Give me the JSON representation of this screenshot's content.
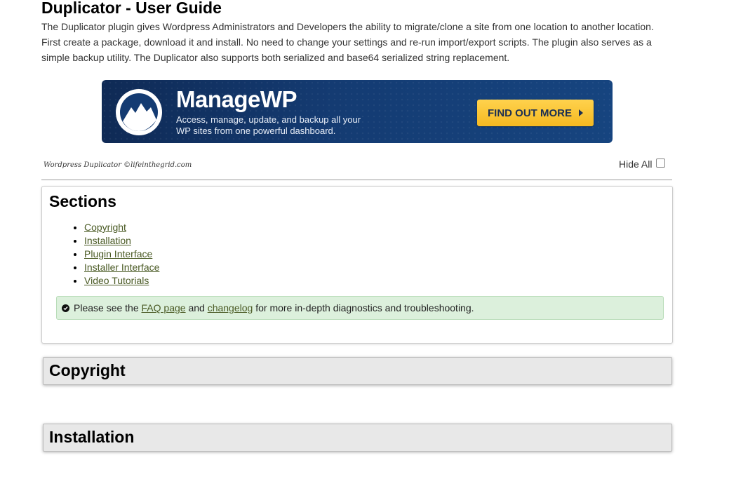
{
  "page": {
    "title": "Duplicator - User Guide",
    "intro": "The Duplicator plugin gives Wordpress Administrators and Developers the ability to migrate/clone a site from one location to another location. First create a package, download it and install. No need to change your settings and re-run import/export scripts. The plugin also serves as a simple backup utility. The Duplicator also supports both serialized and base64 serialized string replacement."
  },
  "banner": {
    "brand": "ManageWP",
    "tagline_line1": "Access, manage, update, and backup all your",
    "tagline_line2": "WP sites from one powerful dashboard.",
    "cta_label": "FIND OUT MORE",
    "colors": {
      "background": "#143b72",
      "button": "#f5b921"
    }
  },
  "credit": "Wordpress Duplicator ©lifeinthegrid.com",
  "hide_all_label": "Hide All",
  "sections": {
    "title": "Sections",
    "links": [
      {
        "label": "Copyright"
      },
      {
        "label": "Installation"
      },
      {
        "label": "Plugin Interface"
      },
      {
        "label": "Installer Interface"
      },
      {
        "label": "Video Tutorials"
      }
    ],
    "note": {
      "prefix": "Please see the",
      "faq_link": "FAQ page",
      "and": "and",
      "changelog_link": "changelog",
      "suffix": "for more in-depth diagnostics and troubleshooting."
    }
  },
  "panels": [
    {
      "title": "Copyright"
    },
    {
      "title": "Installation"
    }
  ]
}
